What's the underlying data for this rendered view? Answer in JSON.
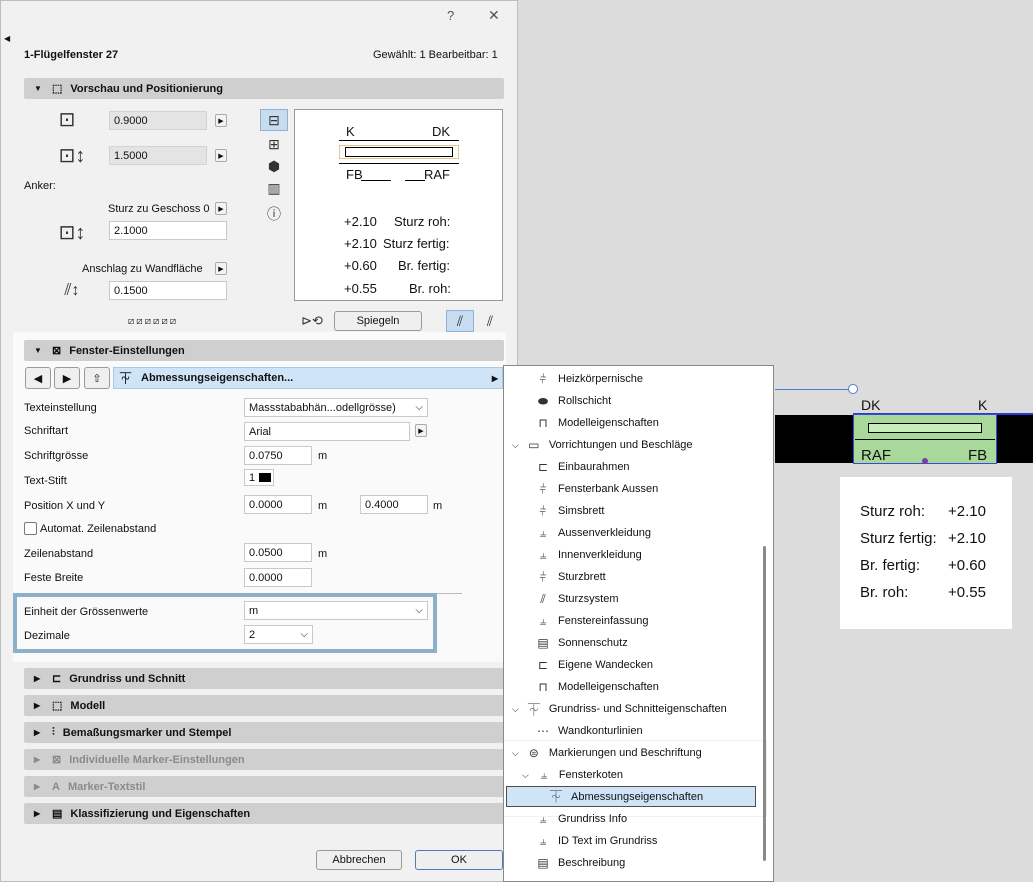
{
  "dialog": {
    "help": "?",
    "close": "✕",
    "element_title": "1-Flügelfenster 27",
    "selection_info": "Gewählt: 1 Bearbeitbar: 1"
  },
  "preview": {
    "header": "Vorschau und Positionierung",
    "width": "0.9000",
    "height": "1.5000",
    "anchor_label": "Anker:",
    "sturz_label": "Sturz zu Geschoss 0",
    "sturz_value": "2.1000",
    "anschlag_label": "Anschlag zu Wandfläche",
    "anschlag_value": "0.1500",
    "diagram": {
      "k": "K",
      "dk": "DK",
      "fb": "FB",
      "raf": "RAF",
      "rows": [
        {
          "value": "+2.10",
          "label": "Sturz roh:"
        },
        {
          "value": "+2.10",
          "label": "Sturz fertig:"
        },
        {
          "value": "+0.60",
          "label": "Br. fertig:"
        },
        {
          "value": "+0.55",
          "label": "Br. roh:"
        }
      ]
    },
    "mirror": "Spiegeln"
  },
  "settings": {
    "header": "Fenster-Einstellungen",
    "nav_label": "Abmessungseigenschaften...",
    "rows": {
      "texteinstellung": {
        "label": "Texteinstellung",
        "value": "Massstababhän...odellgrösse)"
      },
      "schriftart": {
        "label": "Schriftart",
        "value": "Arial"
      },
      "schriftgroesse": {
        "label": "Schriftgrösse",
        "value": "0.0750",
        "unit": "m"
      },
      "textstift": {
        "label": "Text-Stift",
        "value": "1"
      },
      "position": {
        "label": "Position X und Y",
        "x": "0.0000",
        "y": "0.4000",
        "unit": "m"
      },
      "auto_zeilen": {
        "label": "Automat. Zeilenabstand"
      },
      "zeilenabstand": {
        "label": "Zeilenabstand",
        "value": "0.0500",
        "unit": "m"
      },
      "feste_breite": {
        "label": "Feste Breite",
        "value": "0.0000"
      },
      "einheit": {
        "label": "Einheit der Grössenwerte",
        "value": "m"
      },
      "dezimale": {
        "label": "Dezimale",
        "value": "2"
      }
    }
  },
  "sections": [
    "Grundriss und Schnitt",
    "Modell",
    "Bemaßungsmarker und Stempel",
    "Individuelle Marker-Einstellungen",
    "Marker-Textstil",
    "Klassifizierung und Eigenschaften"
  ],
  "footer": {
    "cancel": "Abbrechen",
    "ok": "OK"
  },
  "menu": [
    "Heizkörpernische",
    "Rollschicht",
    "Modelleigenschaften",
    "Vorrichtungen und Beschläge",
    "Einbaurahmen",
    "Fensterbank Aussen",
    "Simsbrett",
    "Aussenverkleidung",
    "Innenverkleidung",
    "Sturzbrett",
    "Sturzsystem",
    "Fenstereinfassung",
    "Sonnenschutz",
    "Eigene Wandecken",
    "Modelleigenschaften",
    "Grundriss- und Schnitteigenschaften",
    "Wandkonturlinien",
    "Markierungen und Beschriftung",
    "Fensterkoten",
    "Abmessungseigenschaften",
    "Grundriss Info",
    "ID Text im Grundriss",
    "Beschreibung"
  ],
  "canvas": {
    "dk": "DK",
    "k": "K",
    "raf": "RAF",
    "fb": "FB",
    "rows": [
      {
        "label": "Sturz roh:",
        "value": "+2.10"
      },
      {
        "label": "Sturz fertig:",
        "value": "+2.10"
      },
      {
        "label": "Br. fertig:",
        "value": "+0.60"
      },
      {
        "label": "Br. roh:",
        "value": "+0.55"
      }
    ]
  },
  "colors": {
    "accent": "#5b8db8",
    "highlight": "#cfe4f7",
    "green": "#a8d99a"
  }
}
